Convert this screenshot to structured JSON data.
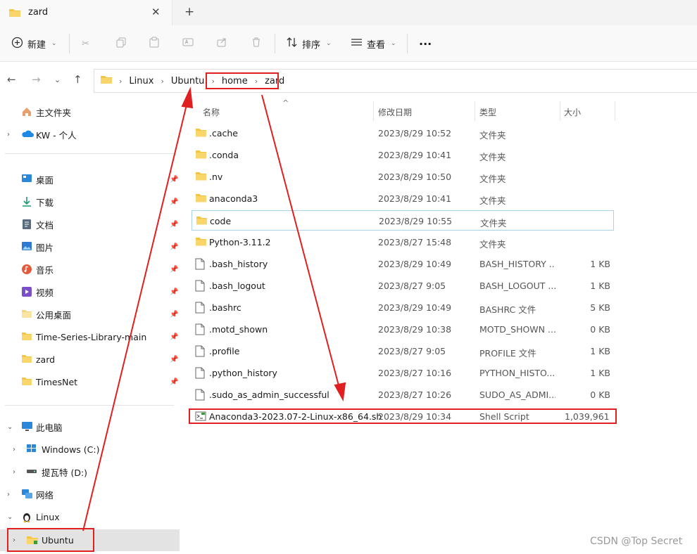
{
  "window": {
    "tab_title": "zard"
  },
  "toolbar": {
    "new_label": "新建",
    "sort_label": "排序",
    "view_label": "查看",
    "more_label": "···"
  },
  "address": {
    "crumbs": [
      "Linux",
      "Ubuntu",
      "home",
      "zard"
    ]
  },
  "sidebar": {
    "top": [
      {
        "label": "主文件夹",
        "icon": "home-icon"
      },
      {
        "label": "KW - 个人",
        "icon": "cloud-icon"
      }
    ],
    "quick": [
      {
        "label": "桌面",
        "icon": "desktop-icon"
      },
      {
        "label": "下载",
        "icon": "download-icon"
      },
      {
        "label": "文档",
        "icon": "document-icon"
      },
      {
        "label": "图片",
        "icon": "picture-icon"
      },
      {
        "label": "音乐",
        "icon": "music-icon"
      },
      {
        "label": "视频",
        "icon": "video-icon"
      },
      {
        "label": "公用桌面",
        "icon": "folder-icon"
      },
      {
        "label": "Time-Series-Library-main",
        "icon": "folder-icon"
      },
      {
        "label": "zard",
        "icon": "folder-icon"
      },
      {
        "label": "TimesNet",
        "icon": "folder-icon"
      }
    ],
    "tree": [
      {
        "label": "此电脑",
        "icon": "pc-icon"
      },
      {
        "label": "Windows (C:)",
        "icon": "drive-icon"
      },
      {
        "label": "提瓦特 (D:)",
        "icon": "drive-icon"
      },
      {
        "label": "网络",
        "icon": "network-icon"
      },
      {
        "label": "Linux",
        "icon": "linux-icon"
      },
      {
        "label": "Ubuntu",
        "icon": "folder-icon"
      }
    ]
  },
  "columns": {
    "name": "名称",
    "date": "修改日期",
    "type": "类型",
    "size": "大小"
  },
  "files": [
    {
      "name": ".cache",
      "date": "2023/8/29 10:52",
      "type": "文件夹",
      "size": "",
      "kind": "folder"
    },
    {
      "name": ".conda",
      "date": "2023/8/29 10:41",
      "type": "文件夹",
      "size": "",
      "kind": "folder"
    },
    {
      "name": ".nv",
      "date": "2023/8/29 10:50",
      "type": "文件夹",
      "size": "",
      "kind": "folder"
    },
    {
      "name": "anaconda3",
      "date": "2023/8/29 10:41",
      "type": "文件夹",
      "size": "",
      "kind": "folder"
    },
    {
      "name": "code",
      "date": "2023/8/29 10:55",
      "type": "文件夹",
      "size": "",
      "kind": "folder"
    },
    {
      "name": "Python-3.11.2",
      "date": "2023/8/27 15:48",
      "type": "文件夹",
      "size": "",
      "kind": "folder"
    },
    {
      "name": ".bash_history",
      "date": "2023/8/29 10:49",
      "type": "BASH_HISTORY ...",
      "size": "1 KB",
      "kind": "file"
    },
    {
      "name": ".bash_logout",
      "date": "2023/8/27 9:05",
      "type": "BASH_LOGOUT ...",
      "size": "1 KB",
      "kind": "file"
    },
    {
      "name": ".bashrc",
      "date": "2023/8/29 10:49",
      "type": "BASHRC 文件",
      "size": "5 KB",
      "kind": "file"
    },
    {
      "name": ".motd_shown",
      "date": "2023/8/29 10:38",
      "type": "MOTD_SHOWN ...",
      "size": "0 KB",
      "kind": "file"
    },
    {
      "name": ".profile",
      "date": "2023/8/27 9:05",
      "type": "PROFILE 文件",
      "size": "1 KB",
      "kind": "file"
    },
    {
      "name": ".python_history",
      "date": "2023/8/27 10:16",
      "type": "PYTHON_HISTO...",
      "size": "1 KB",
      "kind": "file"
    },
    {
      "name": ".sudo_as_admin_successful",
      "date": "2023/8/27 10:26",
      "type": "SUDO_AS_ADMI...",
      "size": "0 KB",
      "kind": "file"
    },
    {
      "name": "Anaconda3-2023.07-2-Linux-x86_64.sh",
      "date": "2023/8/29 10:34",
      "type": "Shell Script",
      "size": "1,039,961...",
      "kind": "script"
    }
  ],
  "colors": {
    "folder": "#f5c542",
    "annotation": "#e02020",
    "selected": "#e3e3e3"
  },
  "watermark": "CSDN @Top Secret"
}
